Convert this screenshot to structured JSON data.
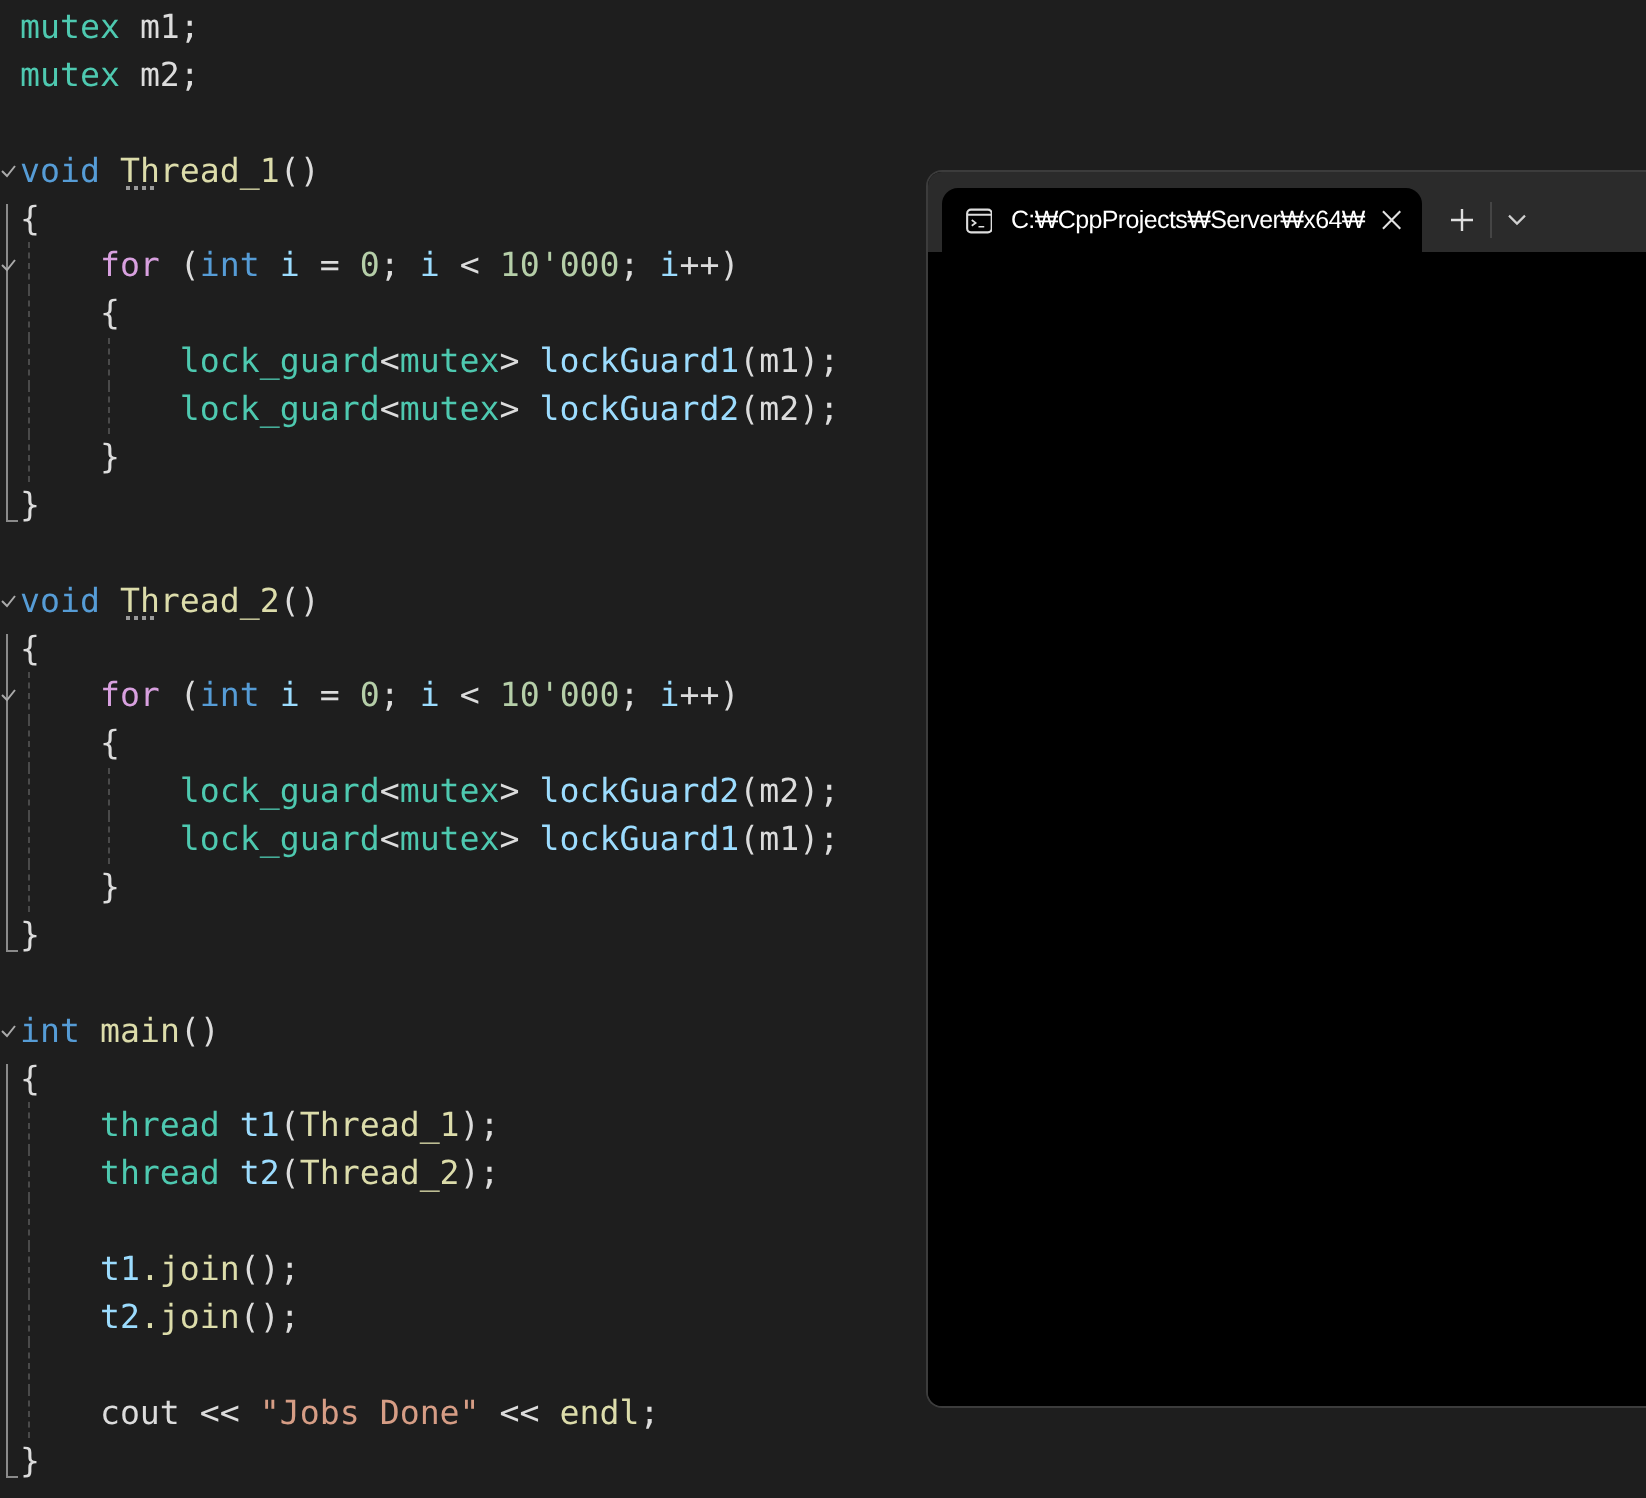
{
  "editor": {
    "lines": [
      {
        "kind": "code",
        "fold": false,
        "tokens": [
          {
            "kind": "type",
            "text": "mutex"
          },
          {
            "kind": "plain",
            "text": " m1;"
          }
        ]
      },
      {
        "kind": "code",
        "fold": false,
        "tokens": [
          {
            "kind": "type",
            "text": "mutex"
          },
          {
            "kind": "plain",
            "text": " m2;"
          }
        ]
      },
      {
        "kind": "blank"
      },
      {
        "kind": "code",
        "fold": true,
        "tokens": [
          {
            "kind": "keyword",
            "text": "void "
          },
          {
            "kind": "func",
            "text": "Thread_1",
            "hint": true
          },
          {
            "kind": "plain",
            "text": "()"
          }
        ]
      },
      {
        "kind": "code",
        "fold": false,
        "tokens": [
          {
            "kind": "plain",
            "text": "{"
          }
        ],
        "children": [
          {
            "kind": "code",
            "fold": true,
            "tokens": [
              {
                "kind": "control",
                "text": "for"
              },
              {
                "kind": "plain",
                "text": " ("
              },
              {
                "kind": "keyword",
                "text": "int "
              },
              {
                "kind": "var",
                "text": "i"
              },
              {
                "kind": "plain",
                "text": " = "
              },
              {
                "kind": "number",
                "text": "0"
              },
              {
                "kind": "plain",
                "text": "; "
              },
              {
                "kind": "var",
                "text": "i"
              },
              {
                "kind": "plain",
                "text": " < "
              },
              {
                "kind": "number",
                "text": "10'000"
              },
              {
                "kind": "plain",
                "text": "; "
              },
              {
                "kind": "var",
                "text": "i"
              },
              {
                "kind": "plain",
                "text": "++)"
              }
            ]
          },
          {
            "kind": "code",
            "fold": false,
            "tokens": [
              {
                "kind": "plain",
                "text": "{"
              }
            ],
            "children": [
              {
                "kind": "code",
                "fold": false,
                "tokens": [
                  {
                    "kind": "type",
                    "text": "lock_guard"
                  },
                  {
                    "kind": "plain",
                    "text": "<"
                  },
                  {
                    "kind": "type",
                    "text": "mutex"
                  },
                  {
                    "kind": "plain",
                    "text": "> "
                  },
                  {
                    "kind": "var",
                    "text": "lockGuard1"
                  },
                  {
                    "kind": "plain",
                    "text": "(m1);"
                  }
                ]
              },
              {
                "kind": "code",
                "fold": false,
                "tokens": [
                  {
                    "kind": "type",
                    "text": "lock_guard"
                  },
                  {
                    "kind": "plain",
                    "text": "<"
                  },
                  {
                    "kind": "type",
                    "text": "mutex"
                  },
                  {
                    "kind": "plain",
                    "text": "> "
                  },
                  {
                    "kind": "var",
                    "text": "lockGuard2"
                  },
                  {
                    "kind": "plain",
                    "text": "(m2);"
                  }
                ]
              }
            ]
          },
          {
            "kind": "code",
            "fold": false,
            "tokens": [
              {
                "kind": "plain",
                "text": "}"
              }
            ]
          }
        ]
      },
      {
        "kind": "code",
        "fold": false,
        "tokens": [
          {
            "kind": "plain",
            "text": "}"
          }
        ]
      },
      {
        "kind": "blank"
      },
      {
        "kind": "code",
        "fold": true,
        "tokens": [
          {
            "kind": "keyword",
            "text": "void "
          },
          {
            "kind": "func",
            "text": "Thread_2",
            "hint": true
          },
          {
            "kind": "plain",
            "text": "()"
          }
        ]
      },
      {
        "kind": "code",
        "fold": false,
        "tokens": [
          {
            "kind": "plain",
            "text": "{"
          }
        ],
        "children": [
          {
            "kind": "code",
            "fold": true,
            "tokens": [
              {
                "kind": "control",
                "text": "for"
              },
              {
                "kind": "plain",
                "text": " ("
              },
              {
                "kind": "keyword",
                "text": "int "
              },
              {
                "kind": "var",
                "text": "i"
              },
              {
                "kind": "plain",
                "text": " = "
              },
              {
                "kind": "number",
                "text": "0"
              },
              {
                "kind": "plain",
                "text": "; "
              },
              {
                "kind": "var",
                "text": "i"
              },
              {
                "kind": "plain",
                "text": " < "
              },
              {
                "kind": "number",
                "text": "10'000"
              },
              {
                "kind": "plain",
                "text": "; "
              },
              {
                "kind": "var",
                "text": "i"
              },
              {
                "kind": "plain",
                "text": "++)"
              }
            ]
          },
          {
            "kind": "code",
            "fold": false,
            "tokens": [
              {
                "kind": "plain",
                "text": "{"
              }
            ],
            "children": [
              {
                "kind": "code",
                "fold": false,
                "tokens": [
                  {
                    "kind": "type",
                    "text": "lock_guard"
                  },
                  {
                    "kind": "plain",
                    "text": "<"
                  },
                  {
                    "kind": "type",
                    "text": "mutex"
                  },
                  {
                    "kind": "plain",
                    "text": "> "
                  },
                  {
                    "kind": "var",
                    "text": "lockGuard2"
                  },
                  {
                    "kind": "plain",
                    "text": "(m2);"
                  }
                ]
              },
              {
                "kind": "code",
                "fold": false,
                "tokens": [
                  {
                    "kind": "type",
                    "text": "lock_guard"
                  },
                  {
                    "kind": "plain",
                    "text": "<"
                  },
                  {
                    "kind": "type",
                    "text": "mutex"
                  },
                  {
                    "kind": "plain",
                    "text": "> "
                  },
                  {
                    "kind": "var",
                    "text": "lockGuard1"
                  },
                  {
                    "kind": "plain",
                    "text": "(m1);"
                  }
                ]
              }
            ]
          },
          {
            "kind": "code",
            "fold": false,
            "tokens": [
              {
                "kind": "plain",
                "text": "}"
              }
            ]
          }
        ]
      },
      {
        "kind": "code",
        "fold": false,
        "tokens": [
          {
            "kind": "plain",
            "text": "}"
          }
        ]
      },
      {
        "kind": "blank"
      },
      {
        "kind": "code",
        "fold": true,
        "tokens": [
          {
            "kind": "keyword",
            "text": "int "
          },
          {
            "kind": "func",
            "text": "main"
          },
          {
            "kind": "plain",
            "text": "()"
          }
        ]
      },
      {
        "kind": "code",
        "fold": false,
        "tokens": [
          {
            "kind": "plain",
            "text": "{"
          }
        ],
        "children": [
          {
            "kind": "code",
            "fold": false,
            "tokens": [
              {
                "kind": "type",
                "text": "thread "
              },
              {
                "kind": "var",
                "text": "t1"
              },
              {
                "kind": "plain",
                "text": "("
              },
              {
                "kind": "func",
                "text": "Thread_1"
              },
              {
                "kind": "plain",
                "text": ");"
              }
            ]
          },
          {
            "kind": "code",
            "fold": false,
            "tokens": [
              {
                "kind": "type",
                "text": "thread "
              },
              {
                "kind": "var",
                "text": "t2"
              },
              {
                "kind": "plain",
                "text": "("
              },
              {
                "kind": "func",
                "text": "Thread_2"
              },
              {
                "kind": "plain",
                "text": ");"
              }
            ]
          },
          {
            "kind": "blank"
          },
          {
            "kind": "code",
            "fold": false,
            "tokens": [
              {
                "kind": "var",
                "text": "t1"
              },
              {
                "kind": "func",
                "text": ".join"
              },
              {
                "kind": "plain",
                "text": "();"
              }
            ]
          },
          {
            "kind": "code",
            "fold": false,
            "tokens": [
              {
                "kind": "var",
                "text": "t2"
              },
              {
                "kind": "func",
                "text": ".join"
              },
              {
                "kind": "plain",
                "text": "();"
              }
            ]
          },
          {
            "kind": "blank"
          },
          {
            "kind": "code",
            "fold": false,
            "tokens": [
              {
                "kind": "plain",
                "text": "cout << "
              },
              {
                "kind": "string",
                "text": "\"Jobs Done\""
              },
              {
                "kind": "plain",
                "text": " << "
              },
              {
                "kind": "func",
                "text": "endl"
              },
              {
                "kind": "plain",
                "text": ";"
              }
            ]
          }
        ]
      },
      {
        "kind": "code",
        "fold": false,
        "tokens": [
          {
            "kind": "plain",
            "text": "}"
          }
        ]
      }
    ]
  },
  "terminal": {
    "tabs": [
      {
        "title": "C:₩CppProjects₩Server₩x64₩",
        "selected": true
      }
    ]
  }
}
